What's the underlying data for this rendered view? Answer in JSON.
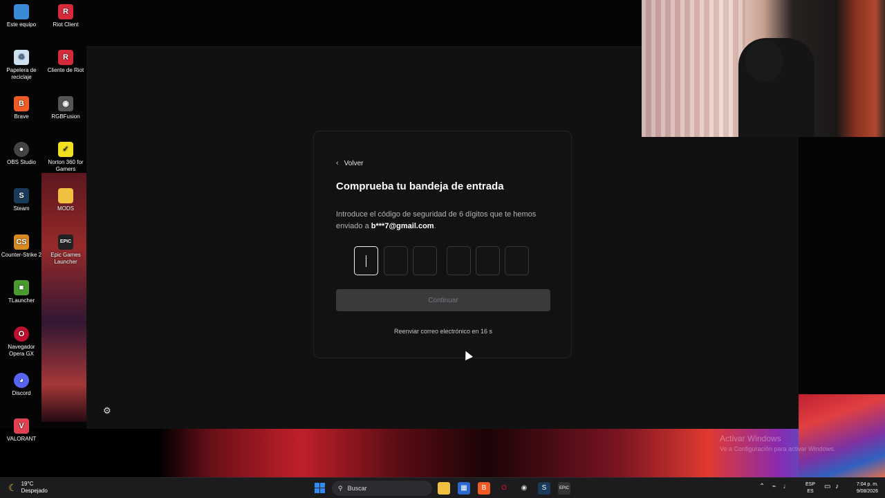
{
  "desktop": {
    "icons": [
      {
        "label": "Este equipo",
        "glyph": "▭",
        "color": "#3a8ad8"
      },
      {
        "label": "Riot Client",
        "glyph": "R",
        "color": "#d42a3a"
      },
      {
        "label": "Papelera de reciclaje",
        "glyph": "♲",
        "color": "#8ab4d8"
      },
      {
        "label": "Cliente de Riot",
        "glyph": "R",
        "color": "#d42a3a"
      },
      {
        "label": "Brave",
        "glyph": "B",
        "color": "#f05a24"
      },
      {
        "label": "RGBFusion",
        "glyph": "◉",
        "color": "#555"
      },
      {
        "label": "OBS Studio",
        "glyph": "●",
        "color": "#444"
      },
      {
        "label": "Norton 360 for Gamers",
        "glyph": "✓",
        "color": "#f0e020"
      },
      {
        "label": "Steam",
        "glyph": "S",
        "color": "#1a3a5a"
      },
      {
        "label": "MODS",
        "glyph": "▬",
        "color": "#f0c040"
      },
      {
        "label": "Counter-Strike 2",
        "glyph": "CS",
        "color": "#d88a20"
      },
      {
        "label": "Epic Games Launcher",
        "glyph": "EPIC",
        "color": "#222"
      },
      {
        "label": "TLauncher",
        "glyph": "■",
        "color": "#4a9a30"
      },
      {
        "label": "Navegador Opera GX",
        "glyph": "O",
        "color": "#c01030"
      },
      {
        "label": "Discord",
        "glyph": "◕",
        "color": "#5865f2"
      },
      {
        "label": "VALORANT",
        "glyph": "V",
        "color": "#e04050"
      }
    ]
  },
  "dialog": {
    "back_label": "Volver",
    "title": "Comprueba tu bandeja de entrada",
    "description_prefix": "Introduce el código de seguridad de 6 dígitos que te hemos enviado a ",
    "email": "b***7@gmail.com",
    "description_suffix": ".",
    "code_digits": [
      "",
      "",
      "",
      "",
      "",
      ""
    ],
    "continue_label": "Continuar",
    "resend_text": "Reenviar correo electrónico en 16 s"
  },
  "watermark": {
    "line1": "Activar Windows",
    "line2": "Ve a Configuración para activar Windows."
  },
  "taskbar": {
    "temperature": "19°C",
    "weather": "Despejado",
    "search_label": "Buscar",
    "lang_primary": "ESP",
    "lang_secondary": "ES",
    "time": "7:04 p. m.",
    "date": "9/08/2026"
  }
}
